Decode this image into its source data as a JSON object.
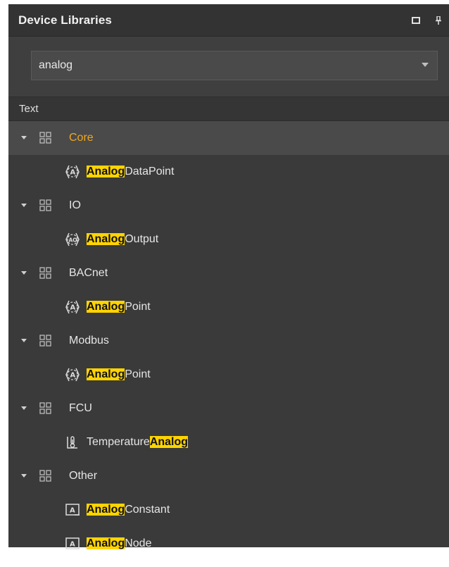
{
  "panel": {
    "title": "Device Libraries"
  },
  "filter": {
    "value": "analog"
  },
  "column": {
    "header": "Text"
  },
  "tree": [
    {
      "group": "Core",
      "selected": true,
      "items": [
        {
          "icon": "analog-datapoint-icon",
          "highlight": "Analog",
          "rest": "DataPoint"
        }
      ]
    },
    {
      "group": "IO",
      "items": [
        {
          "icon": "analog-output-icon",
          "highlight": "Analog",
          "rest": "Output"
        }
      ]
    },
    {
      "group": "BACnet",
      "items": [
        {
          "icon": "analog-point-icon",
          "highlight": "Analog",
          "rest": "Point"
        }
      ]
    },
    {
      "group": "Modbus",
      "items": [
        {
          "icon": "analog-point-icon",
          "highlight": "Analog",
          "rest": "Point"
        }
      ]
    },
    {
      "group": "FCU",
      "items": [
        {
          "icon": "thermometer-icon",
          "prefix": "Temperature",
          "highlight": "Analog"
        }
      ]
    },
    {
      "group": "Other",
      "items": [
        {
          "icon": "analog-constant-icon",
          "highlight": "Analog",
          "rest": "Constant"
        },
        {
          "icon": "analog-node-icon",
          "highlight": "Analog",
          "rest": "Node"
        }
      ]
    }
  ],
  "colors": {
    "accent": "#f0a71e",
    "highlight": "#ffd400"
  }
}
